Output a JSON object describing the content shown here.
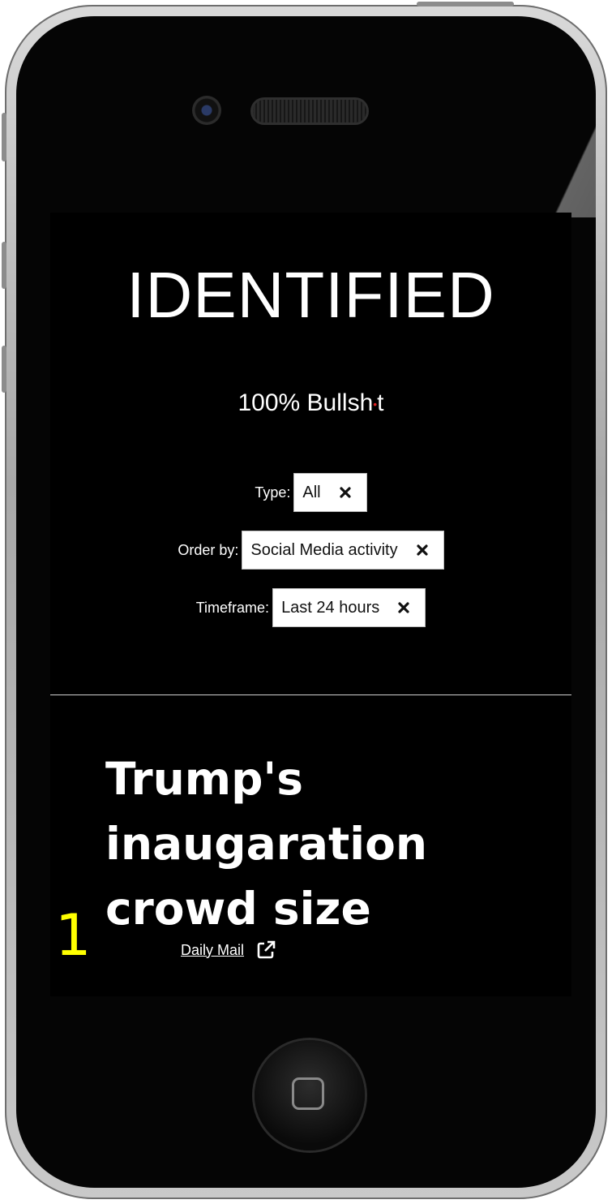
{
  "header": {
    "title": "IDENTIFIED",
    "subtitle_prefix": "100% Bullsh",
    "subtitle_dot": "•",
    "subtitle_suffix": "t"
  },
  "filters": [
    {
      "label": "Type:",
      "value": "All",
      "icon": "close-icon"
    },
    {
      "label": "Order by:",
      "value": "Social Media activity",
      "icon": "close-icon"
    },
    {
      "label": "Timeframe:",
      "value": "Last 24 hours",
      "icon": "close-icon"
    }
  ],
  "story": {
    "rank": "1",
    "title": "Trump's inaugaration crowd size",
    "source": "Daily Mail",
    "source_icon": "external-link-icon"
  },
  "colors": {
    "background": "#000000",
    "text": "#ffffff",
    "rank": "#ffff00",
    "subtitle_dot": "#e02020"
  }
}
